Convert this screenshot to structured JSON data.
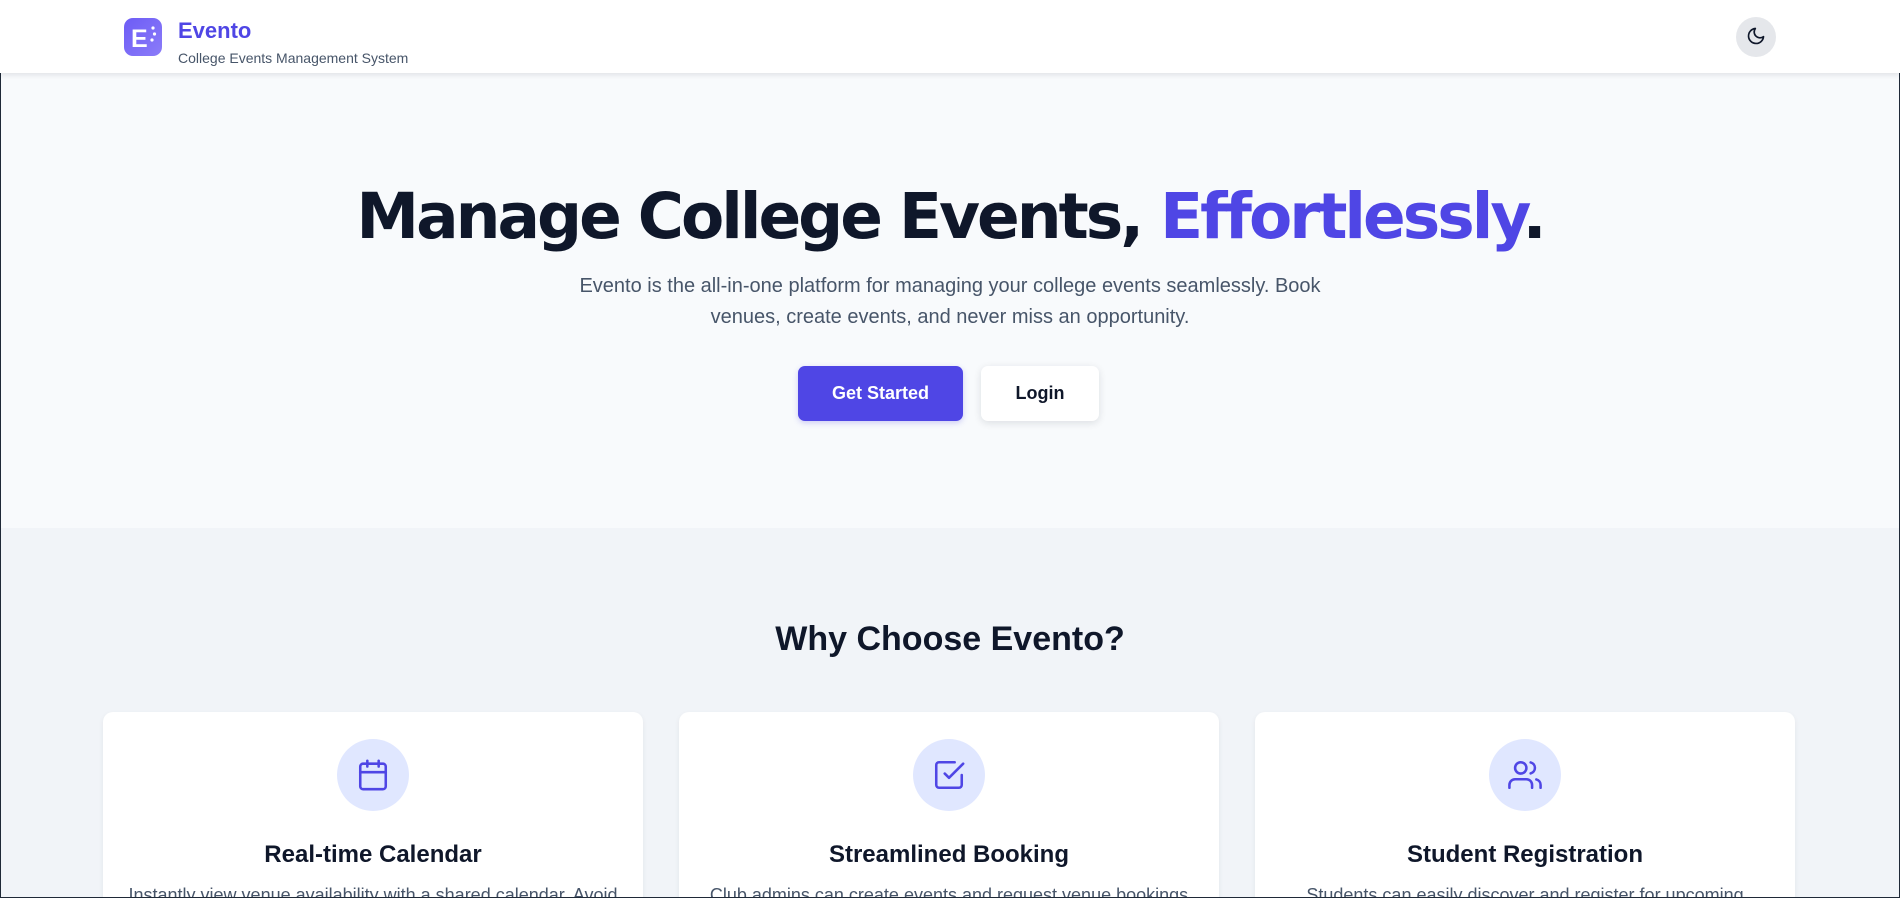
{
  "header": {
    "brand_name": "Evento",
    "brand_tagline": "College Events Management System",
    "logo_letter": "E",
    "theme_toggle_icon": "moon-icon"
  },
  "hero": {
    "title_main": "Manage College Events, ",
    "title_accent": "Effortlessly",
    "title_end": ".",
    "description": "Evento is the all-in-one platform for managing your college events seamlessly. Book venues, create events, and never miss an opportunity.",
    "primary_button": "Get Started",
    "secondary_button": "Login"
  },
  "features": {
    "heading": "Why Choose Evento?",
    "cards": [
      {
        "icon": "calendar-icon",
        "title": "Real-time Calendar",
        "description": "Instantly view venue availability with a shared calendar. Avoid"
      },
      {
        "icon": "check-square-icon",
        "title": "Streamlined Booking",
        "description": "Club admins can create events and request venue bookings"
      },
      {
        "icon": "users-icon",
        "title": "Student Registration",
        "description": "Students can easily discover and register for upcoming"
      }
    ]
  },
  "colors": {
    "accent": "#4f46e5",
    "heading": "#0f172a",
    "body_text": "#475569",
    "icon_bg": "#e0e7ff"
  }
}
